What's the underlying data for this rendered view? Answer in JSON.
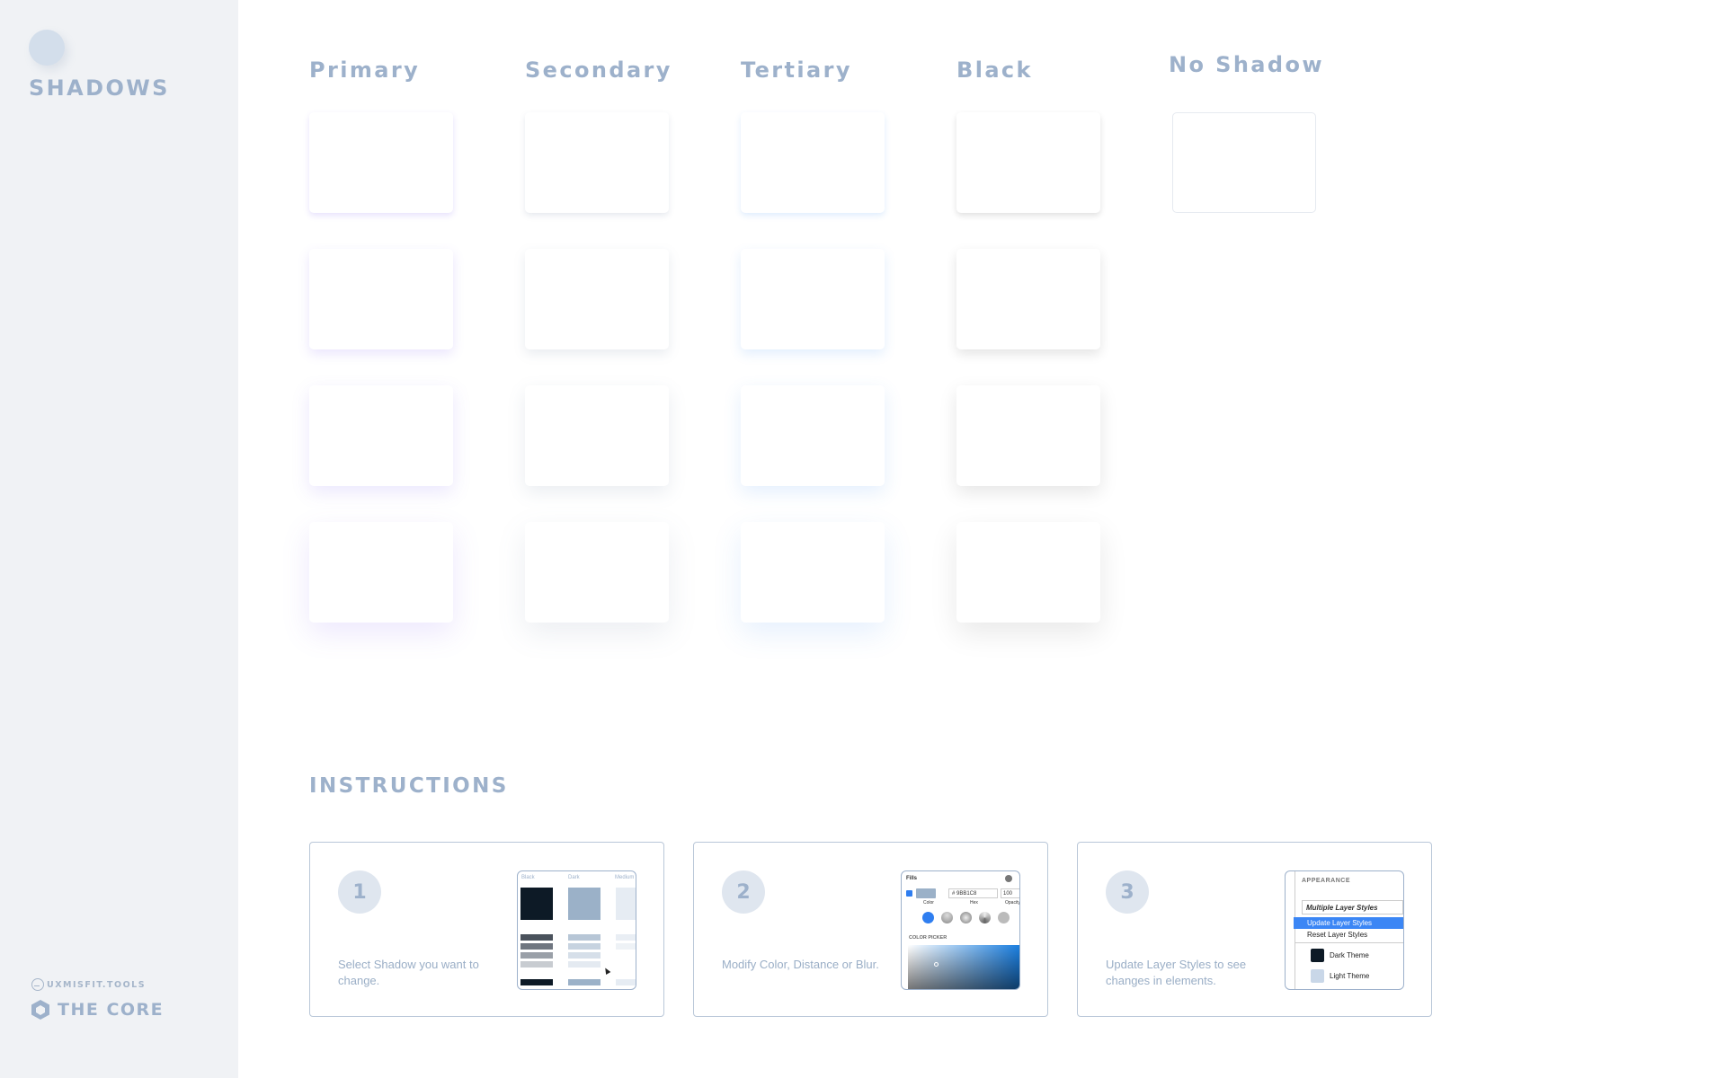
{
  "sidebar": {
    "title": "SHADOWS",
    "brand_small": "UXMISFIT.TOOLS",
    "brand_main": "THE CORE"
  },
  "columns": [
    "Primary",
    "Secondary",
    "Tertiary",
    "Black",
    "No Shadow"
  ],
  "colors": {
    "primary_shadow": "#7c5cf0",
    "secondary_shadow": "#6a7f99",
    "tertiary_shadow": "#3f8df0",
    "black_shadow": "#000000",
    "text_accent": "#9db1cb",
    "sidebar_bg": "#f0f2f5"
  },
  "instructions": {
    "title": "INSTRUCTIONS",
    "steps": [
      {
        "num": "1",
        "text": "Select Shadow you want to change."
      },
      {
        "num": "2",
        "text": "Modify Color, Distance or Blur."
      },
      {
        "num": "3",
        "text": "Update Layer Styles to see changes in elements."
      }
    ],
    "shot1": {
      "cols": [
        "Black",
        "Dark",
        "Medium"
      ]
    },
    "shot2": {
      "fills": "Fills",
      "hex": "# 9BB1C8",
      "pct": "100",
      "sub1": "Color",
      "sub2": "Hex",
      "sub3": "Opacity",
      "picker": "COLOR PICKER"
    },
    "shot3": {
      "header": "APPEARANCE",
      "multi": "Multiple Layer Styles",
      "update": "Update Layer Styles",
      "reset": "Reset Layer Styles",
      "dark": "Dark Theme",
      "light": "Light Theme"
    }
  }
}
